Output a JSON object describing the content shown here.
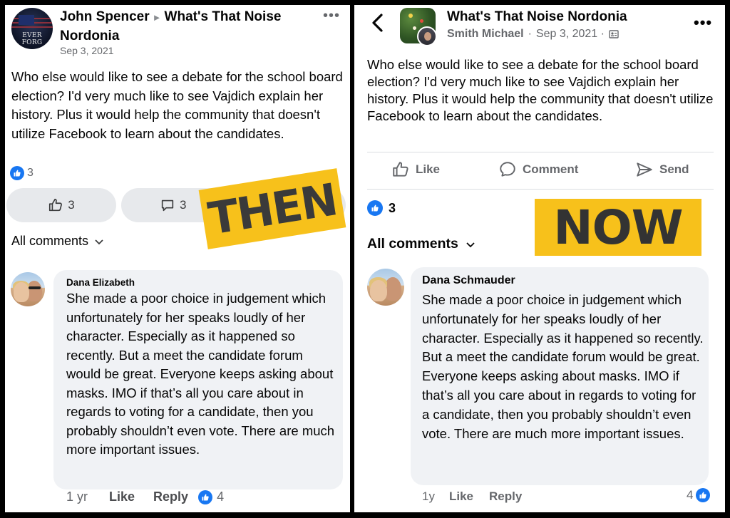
{
  "then_panel": {
    "author": "John Spencer",
    "group": "What's That Noise Nordonia",
    "avatar_text": "EVER FORG",
    "date": "Sep 3, 2021",
    "more_icon": "more-horizontal-icon",
    "body": "Who else would like to see a debate for the school board election? I'd very much like to see Vajdich explain her history. Plus it would help the community that doesn't utilize Facebook to learn about the candidates.",
    "reaction_count": "3",
    "like_button_count": "3",
    "comment_button_count": "3",
    "sticker": "THEN",
    "all_comments_label": "All comments",
    "comment": {
      "author": "Dana Elizabeth",
      "text": "She made a poor choice in judgement which unfortunately for her speaks loudly of her character. Especially as it happened so recently. But a meet the candidate forum would be great. Everyone keeps asking about masks. IMO if that’s all you care about in regards to voting for a candidate, then you probably shouldn’t even vote. There are much more important issues.",
      "time": "1 yr",
      "like_label": "Like",
      "reply_label": "Reply",
      "reaction_count": "4"
    }
  },
  "now_panel": {
    "group": "What's That Noise Nordonia",
    "author": "Smith Michael",
    "date": "Sep 3, 2021 ·",
    "body": "Who else would like to see a debate for the school board election? I'd very much like to see Vajdich explain her history. Plus it would help the community that doesn't utilize Facebook to learn about the candidates.",
    "actions": {
      "like": "Like",
      "comment": "Comment",
      "send": "Send"
    },
    "reaction_count": "3",
    "sticker": "NOW",
    "all_comments_label": "All comments",
    "comment": {
      "author": "Dana Schmauder",
      "text": "She made a poor choice in judgement which unfortunately for her speaks loudly of her character. Especially as it happened so recently. But a meet the candidate forum would be great. Everyone keeps asking about masks. IMO if that’s all you care about in regards to voting for a candidate, then you probably shouldn’t even vote. There are much more important issues.",
      "time": "1y",
      "like_label": "Like",
      "reply_label": "Reply",
      "reaction_count": "4"
    }
  },
  "colors": {
    "facebook_blue": "#1877f2",
    "sticker_yellow": "#f7c11b",
    "bubble_gray": "#f0f2f5",
    "secondary_text": "#65676b"
  }
}
